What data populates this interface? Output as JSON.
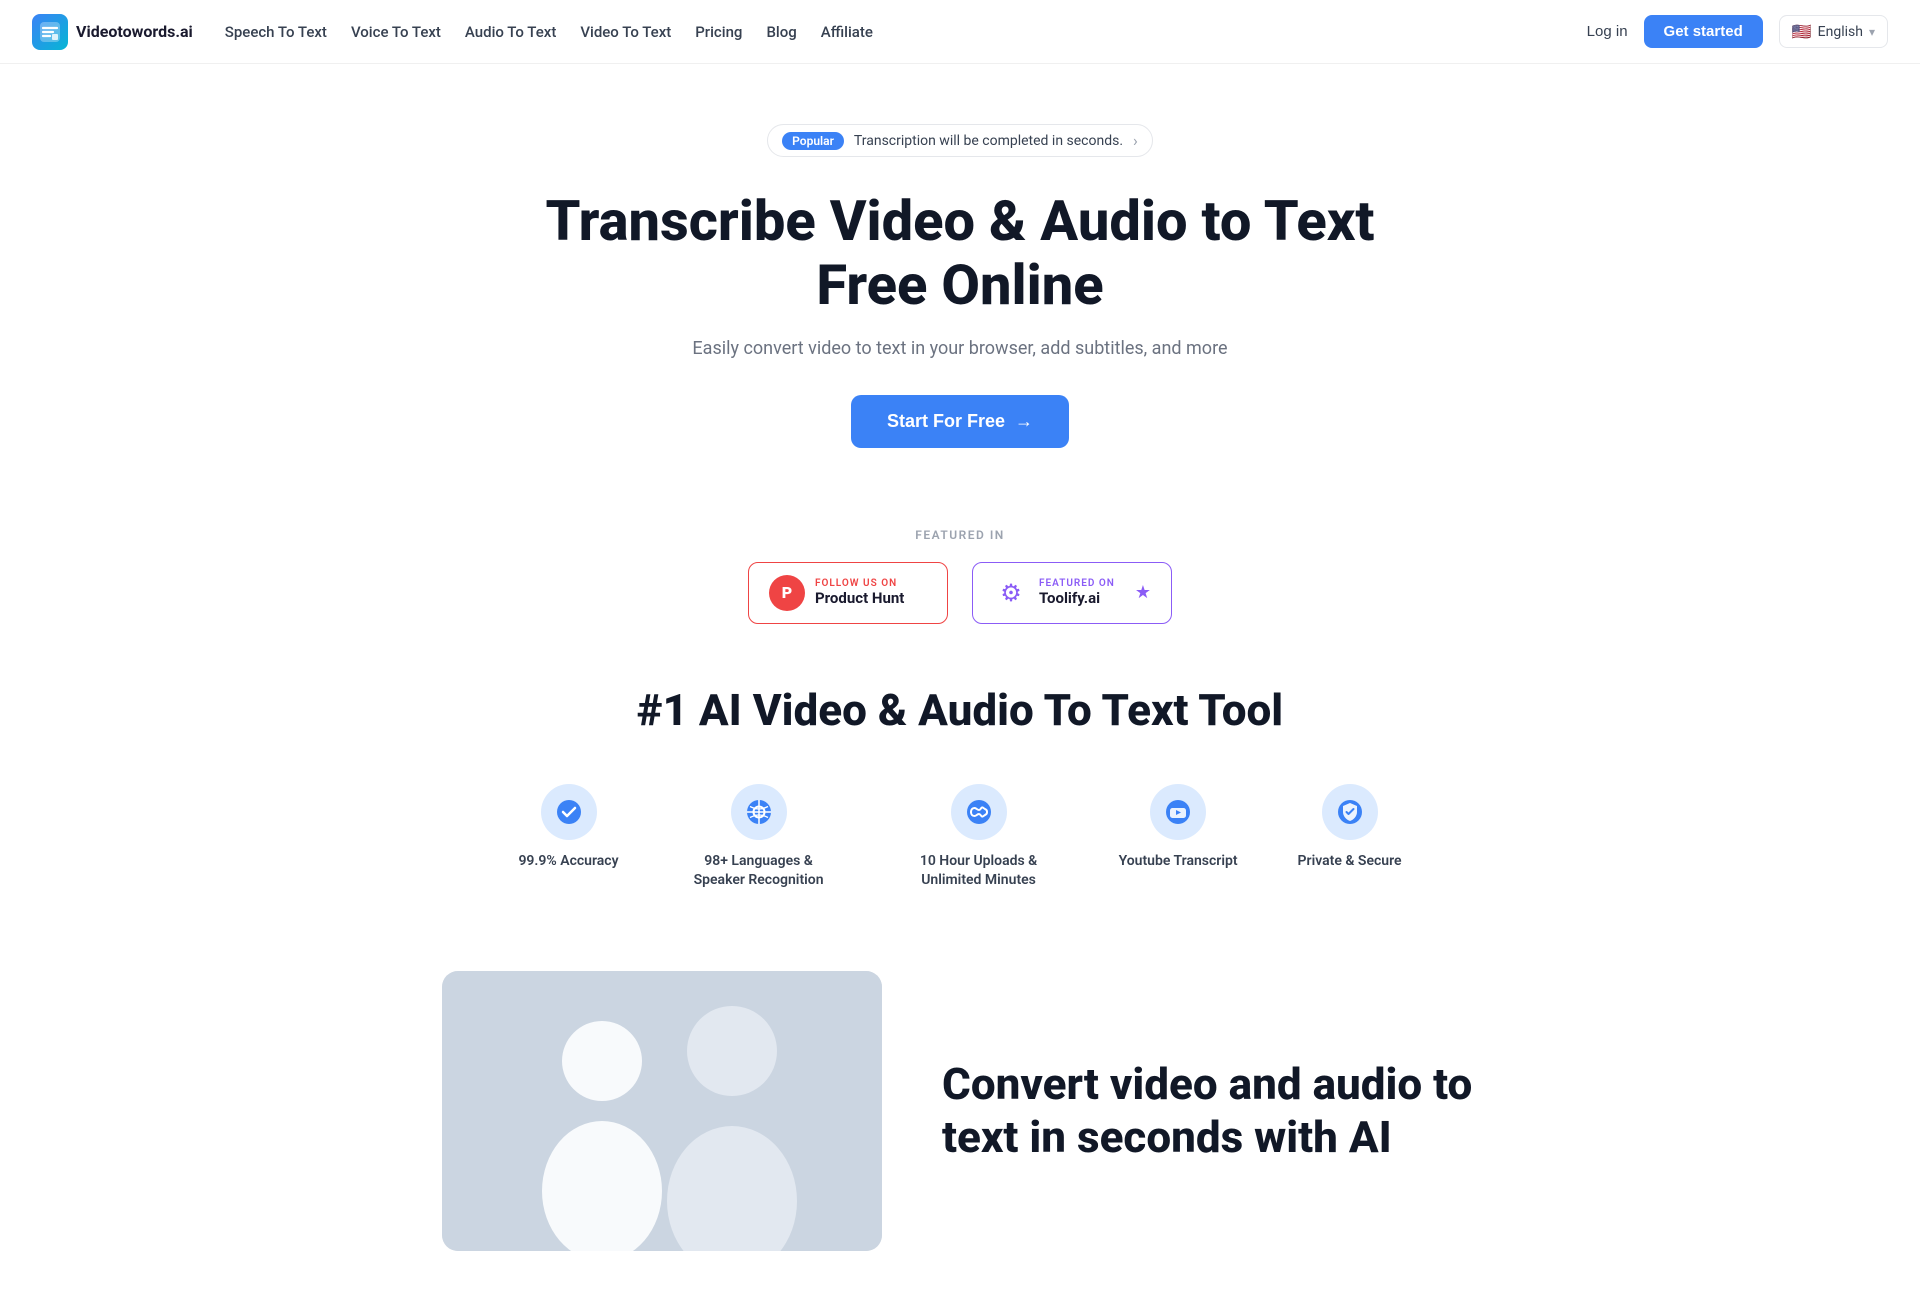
{
  "navbar": {
    "logo_text": "Videotowords.ai",
    "nav_items": [
      {
        "label": "Speech To Text",
        "href": "#"
      },
      {
        "label": "Voice To Text",
        "href": "#"
      },
      {
        "label": "Audio To Text",
        "href": "#"
      },
      {
        "label": "Video To Text",
        "href": "#"
      },
      {
        "label": "Pricing",
        "href": "#"
      },
      {
        "label": "Blog",
        "href": "#"
      },
      {
        "label": "Affiliate",
        "href": "#"
      }
    ],
    "login_label": "Log in",
    "get_started_label": "Get started",
    "language_label": "English"
  },
  "hero": {
    "badge_popular": "Popular",
    "badge_text": "Transcription will be completed in seconds.",
    "title": "Transcribe Video & Audio to Text Free Online",
    "subtitle": "Easily convert video to text in your browser, add subtitles, and more",
    "cta_label": "Start For Free",
    "cta_arrow": "→"
  },
  "featured": {
    "label": "FEATURED IN",
    "product_hunt": {
      "follow_text": "FOLLOW US ON",
      "name": "Product Hunt"
    },
    "toolify": {
      "featured_text": "FEATURED ON",
      "name": "Toolify.ai"
    }
  },
  "ai_tool": {
    "title": "#1 AI Video & Audio To Text Tool",
    "features": [
      {
        "id": "accuracy",
        "label": "99.9% Accuracy",
        "icon": "checkmark"
      },
      {
        "id": "languages",
        "label": "98+ Languages & Speaker Recognition",
        "icon": "globe"
      },
      {
        "id": "uploads",
        "label": "10 Hour Uploads & Unlimited Minutes",
        "icon": "infinity"
      },
      {
        "id": "youtube",
        "label": "Youtube Transcript",
        "icon": "youtube"
      },
      {
        "id": "private",
        "label": "Private & Secure",
        "icon": "shield"
      }
    ]
  },
  "bottom": {
    "title": "Convert video and audio to text in seconds with AI"
  }
}
